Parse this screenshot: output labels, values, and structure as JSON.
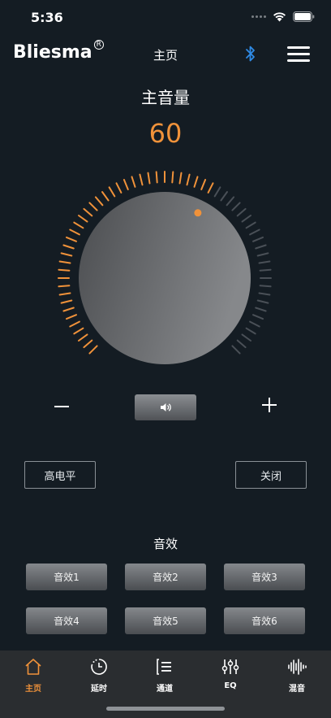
{
  "status": {
    "time": "5:36"
  },
  "nav": {
    "logo": "Bliesma",
    "logo_mark": "R",
    "title": "主页"
  },
  "volume": {
    "title": "主音量",
    "value": "60",
    "level_percent": 60
  },
  "controls": {
    "level_label": "高电平",
    "close_label": "关闭"
  },
  "effects": {
    "title": "音效",
    "items": [
      "音效1",
      "音效2",
      "音效3",
      "音效4",
      "音效5",
      "音效6"
    ]
  },
  "tabs": [
    {
      "label": "主页",
      "icon": "home-icon",
      "active": true
    },
    {
      "label": "延时",
      "icon": "timer-icon",
      "active": false
    },
    {
      "label": "通道",
      "icon": "channel-list-icon",
      "active": false
    },
    {
      "label": "EQ",
      "icon": "equalizer-icon",
      "active": false
    },
    {
      "label": "混音",
      "icon": "waveform-icon",
      "active": false
    }
  ],
  "colors": {
    "accent": "#f0923a",
    "background": "#141c23",
    "bluetooth": "#2f8be6",
    "tab_bar": "#2a2d30",
    "inactive_tick": "#4a5057"
  }
}
